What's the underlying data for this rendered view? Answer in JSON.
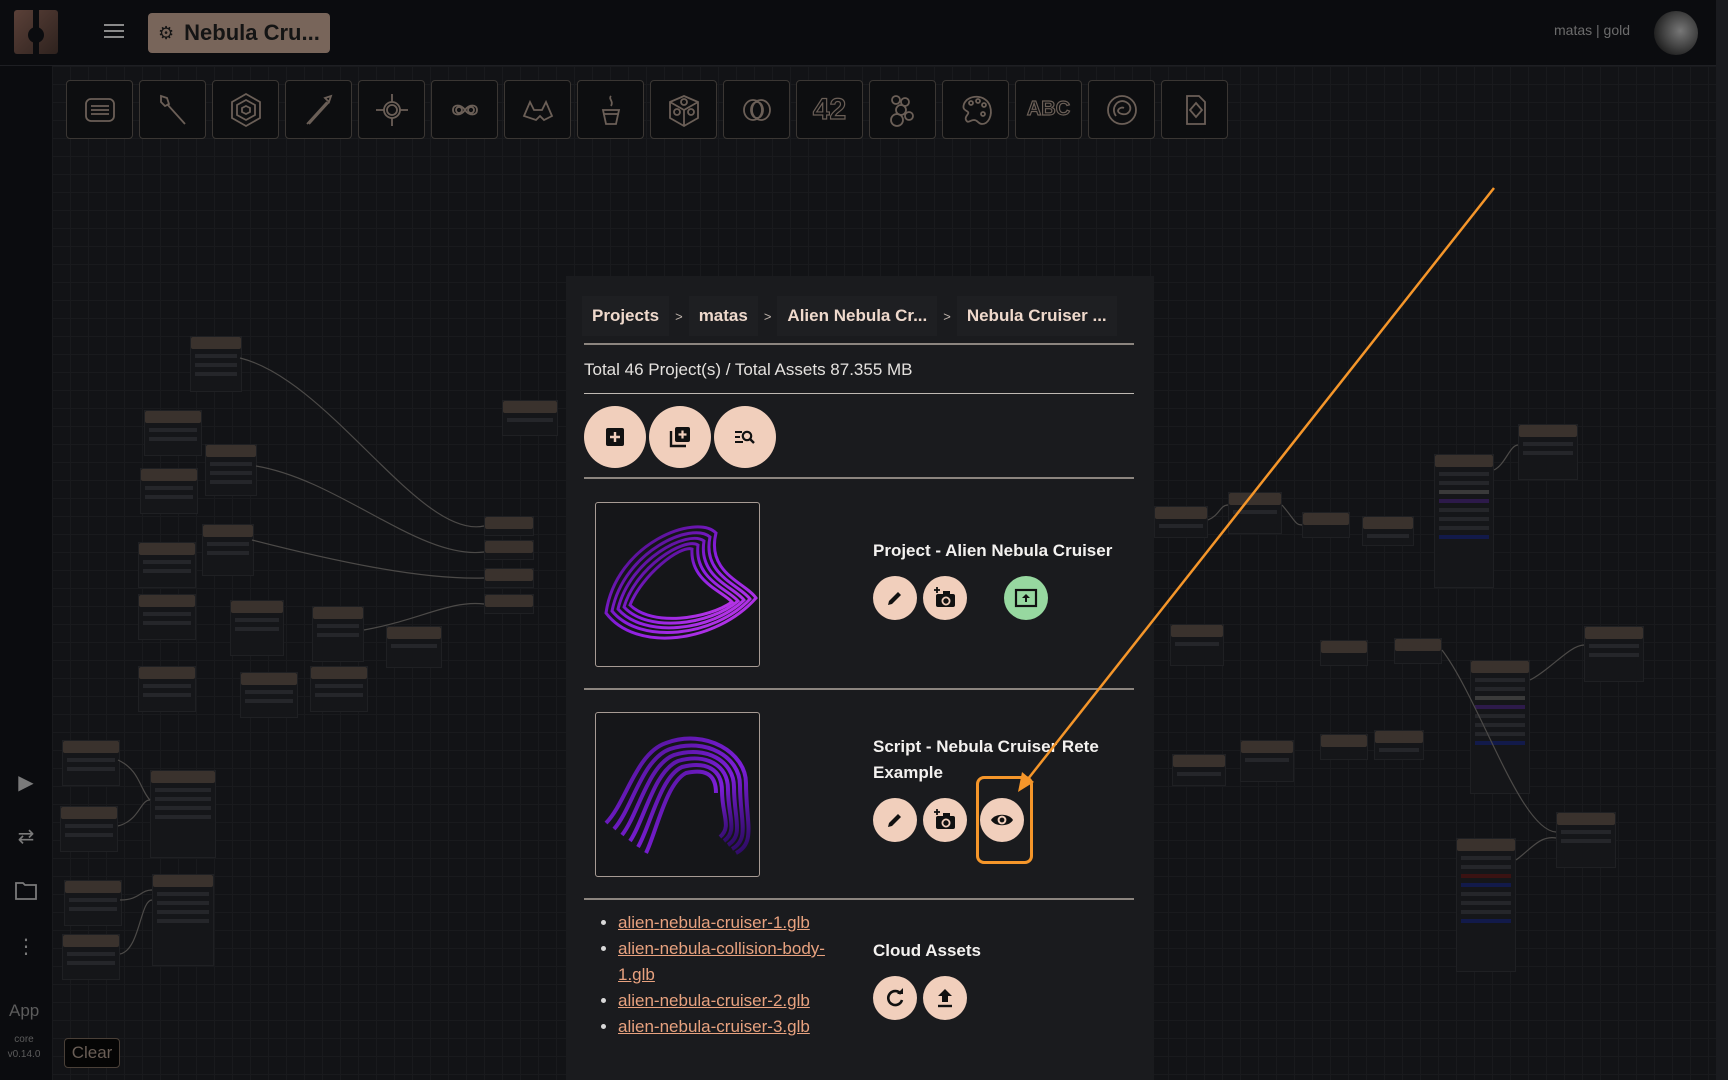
{
  "header": {
    "logo": "app-logo",
    "menu_icon": "hamburger-menu-icon",
    "project_title": "Nebula Cru...",
    "user": "matas | gold"
  },
  "leftbar": {
    "icons": [
      "play-icon",
      "swap-icon",
      "folder-icon",
      "more-vertical-icon"
    ],
    "app_label": "App",
    "core_label": "core",
    "version": "v0.14.0",
    "clear_label": "Clear"
  },
  "toolbar": {
    "tools": [
      "panel-icon",
      "brush-icon",
      "hexagon-icon",
      "arrow-tool-icon",
      "target-icon",
      "infinity-icon",
      "vr-glasses-icon",
      "coffee-cup-icon",
      "cube-icon",
      "rings-icon",
      "number-icon",
      "bubbles-icon",
      "palette-icon",
      "text-icon",
      "spiral-icon",
      "document-icon"
    ],
    "number_text": "42",
    "text_text": "ABC"
  },
  "panel": {
    "breadcrumbs": [
      "Projects",
      "matas",
      "Alien Nebula Cr...",
      "Nebula Cruiser ..."
    ],
    "breadcrumb_separator": ">",
    "summary": "Total 46 Project(s) / Total Assets 87.355 MB",
    "actions": [
      "add-project-button",
      "duplicate-project-button",
      "search-projects-button"
    ],
    "items": [
      {
        "title": "Project - Alien Nebula Cruiser",
        "buttons": [
          "edit-button",
          "add-screenshot-button",
          "publish-button"
        ]
      },
      {
        "title": "Script - Nebula Cruiser Rete Example",
        "buttons": [
          "edit-button",
          "add-screenshot-button",
          "view-button"
        ]
      }
    ],
    "assets": [
      "alien-nebula-cruiser-1.glb",
      "alien-nebula-collision-body-1.glb",
      "alien-nebula-cruiser-2.glb",
      "alien-nebula-cruiser-3.glb"
    ],
    "cloud_assets_title": "Cloud Assets",
    "cloud_buttons": [
      "refresh-button",
      "upload-button"
    ]
  },
  "annotation": {
    "color": "#f5962a",
    "target": "view-button"
  },
  "colors": {
    "accent": "#f1cfbc",
    "green": "#97d8a0",
    "link": "#e8a27f"
  }
}
